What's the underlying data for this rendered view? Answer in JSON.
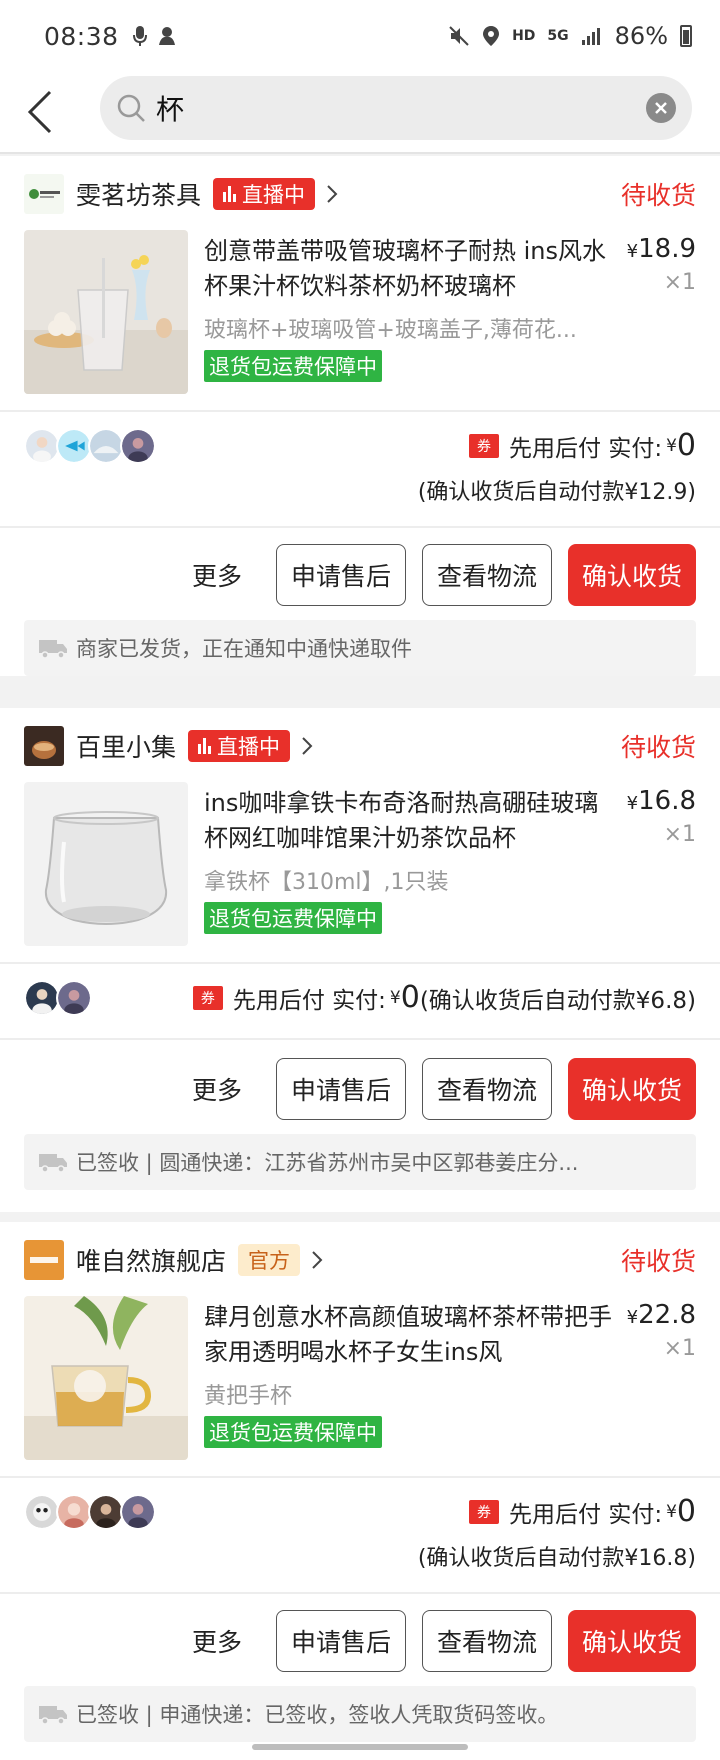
{
  "status_bar": {
    "time": "08:38",
    "network": "HD",
    "signal": "5G",
    "battery": "86%"
  },
  "search": {
    "query": "杯",
    "icons": [
      "back-arrow-icon",
      "search-icon",
      "clear-icon"
    ]
  },
  "orders": [
    {
      "shop_name": "雯茗坊茶具",
      "badge": "直播中",
      "badge_type": "live",
      "status": "待收货",
      "title": "创意带盖带吸管玻璃杯子耐热 ins风水杯果汁杯饮料茶杯奶杯玻璃杯",
      "price_symbol": "¥",
      "price": "18.9",
      "quantity": "×1",
      "sku": "玻璃杯+玻璃吸管+玻璃盖子,薄荷花...",
      "guarantee": "退货包运费保障中",
      "coupon": "券",
      "pay_label": "先用后付 实付:",
      "pay_amount": "0",
      "auto_pay": "(确认收货后自动付款¥12.9)",
      "logistics": "商家已发货，正在通知中通快递取件"
    },
    {
      "shop_name": "百里小集",
      "badge": "直播中",
      "badge_type": "live",
      "status": "待收货",
      "title": "ins咖啡拿铁卡布奇洛耐热高硼硅玻璃杯网红咖啡馆果汁奶茶饮品杯",
      "price_symbol": "¥",
      "price": "16.8",
      "quantity": "×1",
      "sku": "拿铁杯【310ml】,1只装",
      "guarantee": "退货包运费保障中",
      "coupon": "券",
      "pay_label": "先用后付 实付:",
      "pay_amount": "0",
      "auto_pay": "(确认收货后自动付款¥6.8)",
      "logistics": "已签收 | 圆通快递：江苏省苏州市吴中区郭巷姜庄分..."
    },
    {
      "shop_name": "唯自然旗舰店",
      "badge": "官方",
      "badge_type": "official",
      "status": "待收货",
      "title": "肆月创意水杯高颜值玻璃杯茶杯带把手家用透明喝水杯子女生ins风",
      "price_symbol": "¥",
      "price": "22.8",
      "quantity": "×1",
      "sku": "黄把手杯",
      "guarantee": "退货包运费保障中",
      "coupon": "券",
      "pay_label": "先用后付 实付:",
      "pay_amount": "0",
      "auto_pay": "(确认收货后自动付款¥16.8)",
      "logistics": "已签收 | 申通快递：已签收，签收人凭取货码签收。"
    }
  ],
  "buttons": {
    "more": "更多",
    "after_sale": "申请售后",
    "logistics": "查看物流",
    "confirm": "确认收货"
  },
  "colors": {
    "accent_red": "#e8302a",
    "guarantee_green": "#2fb443",
    "official_bg": "#fdeccc",
    "official_text": "#c7621a"
  }
}
